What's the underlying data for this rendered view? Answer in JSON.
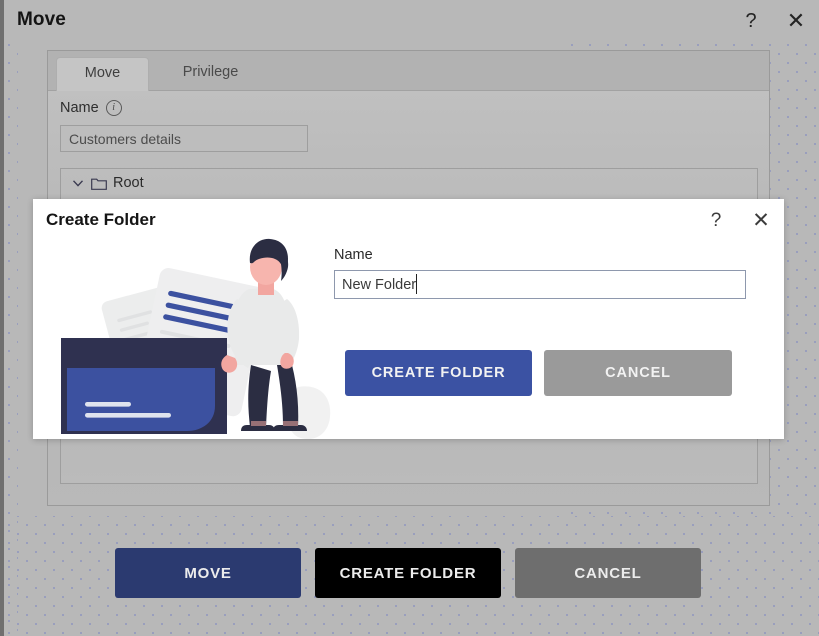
{
  "window": {
    "title": "Move",
    "help_icon": "question-mark-icon",
    "close_icon": "close-x-icon"
  },
  "panel": {
    "tabs": [
      {
        "label": "Move",
        "active": true
      },
      {
        "label": "Privilege",
        "active": false
      }
    ],
    "name_field": {
      "label": "Name",
      "info_icon": "i",
      "value": "Customers details",
      "placeholder": "Name"
    },
    "tree": {
      "root": {
        "label": "Root",
        "expanded": true,
        "chevron_icon": "chevron-down-icon",
        "folder_icon": "folder-icon"
      }
    }
  },
  "footer": {
    "buttons": [
      {
        "label": "MOVE",
        "color": "#2b3a70"
      },
      {
        "label": "CREATE FOLDER",
        "color": "#000000"
      },
      {
        "label": "CANCEL",
        "color": "#6e6e6e"
      }
    ]
  },
  "modal": {
    "title": "Create Folder",
    "help_icon": "question-mark-icon",
    "close_icon": "close-x-icon",
    "illustration": "person-with-folder-and-documents-illustration",
    "name_field": {
      "label": "Name",
      "value": "New Folder",
      "placeholder": "Name"
    },
    "buttons": [
      {
        "label": "CREATE FOLDER",
        "color": "#3b52a3"
      },
      {
        "label": "CANCEL",
        "color": "#9a9a9a"
      }
    ]
  },
  "theme": {
    "accent_blue": "#3b52a3",
    "navy": "#2b3a70",
    "illustration_blue": "#3c51a0",
    "illustration_dark": "#2f3150",
    "backdrop_gray": "#b8b8b8",
    "dot_pattern_color": "#8b93c0"
  }
}
